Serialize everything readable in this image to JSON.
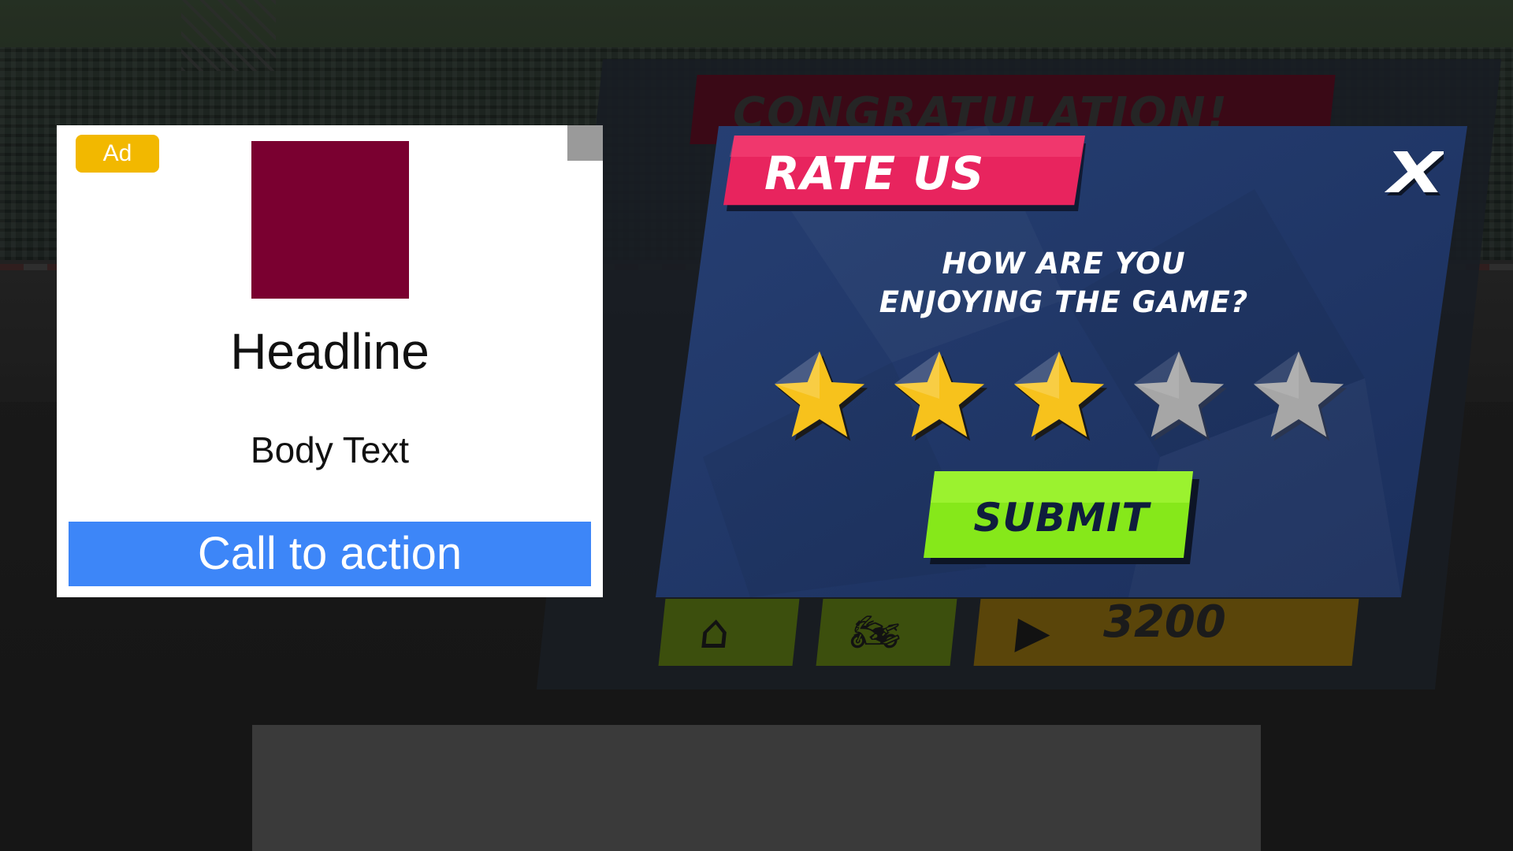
{
  "background": {
    "results_title": "CONGRATULATION!",
    "reward_amount": "3200"
  },
  "ad": {
    "badge": "Ad",
    "image_color": "#7a0030",
    "headline": "Headline",
    "body": "Body Text",
    "cta": "Call to action"
  },
  "rate_popup": {
    "title": "RATE US",
    "close_label": "X",
    "question_line1": "HOW ARE YOU",
    "question_line2": "ENJOYING THE GAME?",
    "rating": 3,
    "max_rating": 5,
    "submit_label": "SUBMIT",
    "colors": {
      "panel": "#1f3563",
      "banner": "#e8245e",
      "star_filled": "#f7c21c",
      "star_empty": "#a6a6a6",
      "submit": "#86e81a"
    }
  }
}
